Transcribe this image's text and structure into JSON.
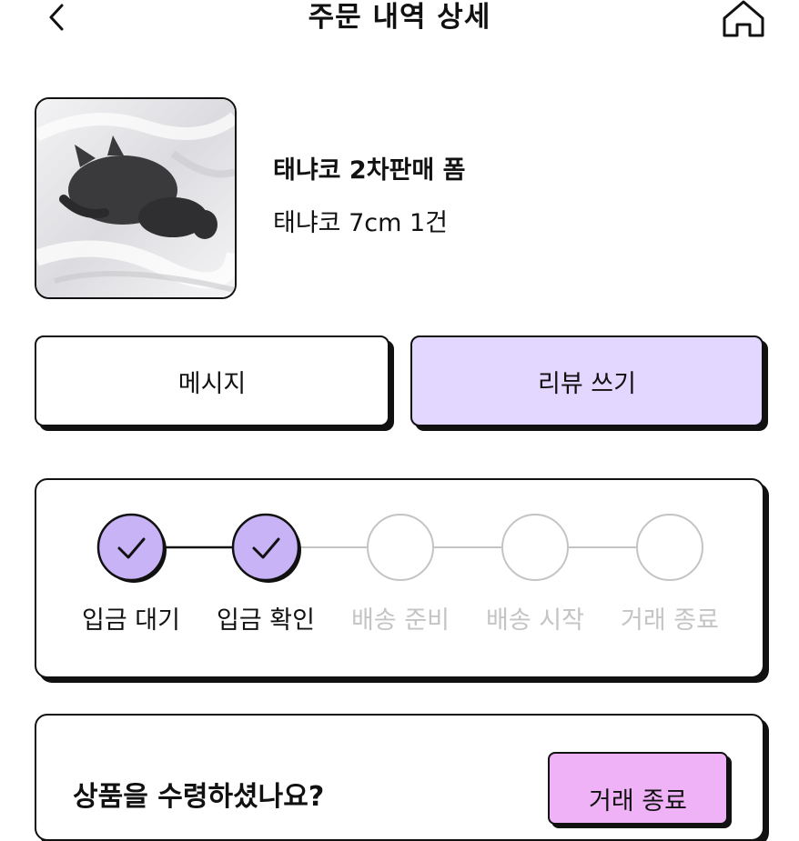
{
  "header": {
    "title": "주문 내역 상세",
    "back_icon": "chevron-left-icon",
    "home_icon": "home-icon"
  },
  "product": {
    "name": "태냐코 2차판매 폼",
    "option": "태냐코 7cm 1건"
  },
  "actions": {
    "message_label": "메시지",
    "review_label": "리뷰 쓰기"
  },
  "progress": {
    "steps": [
      {
        "label": "입금 대기",
        "done": true
      },
      {
        "label": "입금 확인",
        "done": true
      },
      {
        "label": "배송 준비",
        "done": false
      },
      {
        "label": "배송 시작",
        "done": false
      },
      {
        "label": "거래 종료",
        "done": false
      }
    ]
  },
  "received": {
    "question": "상품을 수령하셨나요?",
    "complete_label": "거래 종료"
  },
  "colors": {
    "accent_purple": "#c9b3f7",
    "review_bg": "#e3d6ff",
    "complete_bg": "#f0b2f6",
    "pending_gray": "#c4c4c4",
    "border": "#111111"
  }
}
